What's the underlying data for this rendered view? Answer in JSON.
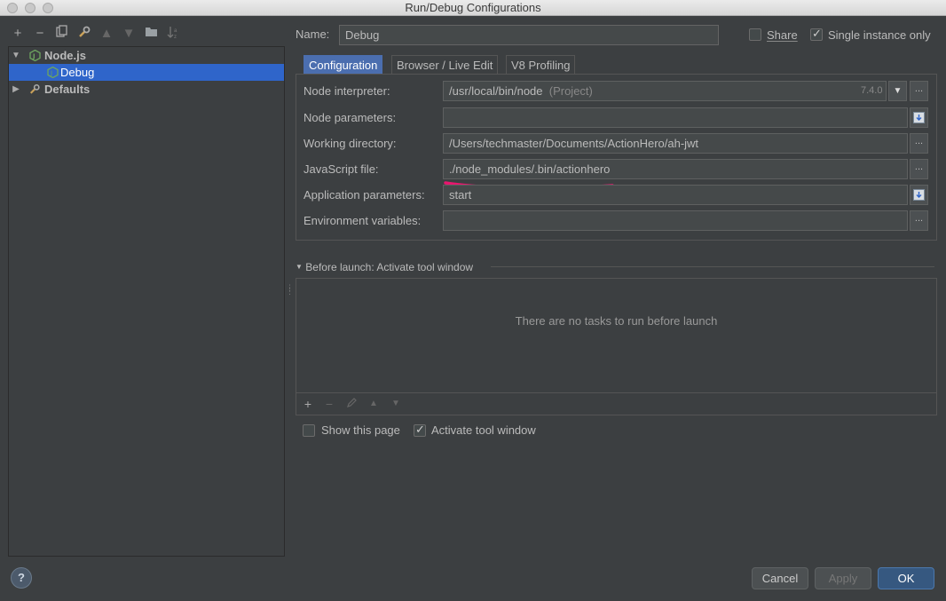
{
  "window": {
    "title": "Run/Debug Configurations"
  },
  "tree": {
    "items": [
      {
        "label": "Node.js",
        "icon": "nodejs-icon"
      },
      {
        "label": "Debug",
        "icon": "nodejs-icon"
      },
      {
        "label": "Defaults",
        "icon": "wrench-icon"
      }
    ]
  },
  "header": {
    "name_label": "Name:",
    "name_value": "Debug",
    "share_label": "Share",
    "single_instance_label": "Single instance only"
  },
  "tabs": [
    {
      "label": "Configuration"
    },
    {
      "label": "Browser / Live Edit"
    },
    {
      "label": "V8 Profiling"
    }
  ],
  "config": {
    "node_interpreter": {
      "label": "Node interpreter:",
      "value": "/usr/local/bin/node",
      "hint": "(Project)",
      "version": "7.4.0"
    },
    "node_parameters": {
      "label": "Node parameters:",
      "value": ""
    },
    "working_directory": {
      "label": "Working directory:",
      "value": "/Users/techmaster/Documents/ActionHero/ah-jwt"
    },
    "javascript_file": {
      "label": "JavaScript file:",
      "value": "./node_modules/.bin/actionhero"
    },
    "application_parameters": {
      "label": "Application parameters:",
      "value": "start"
    },
    "environment_variables": {
      "label": "Environment variables:",
      "value": ""
    }
  },
  "before_launch": {
    "title": "Before launch: Activate tool window",
    "empty_text": "There are no tasks to run before launch",
    "show_this_page_label": "Show this page",
    "activate_tool_window_label": "Activate tool window"
  },
  "buttons": {
    "help": "?",
    "cancel": "Cancel",
    "apply": "Apply",
    "ok": "OK"
  },
  "colors": {
    "background": "#3c3f41",
    "selection": "#2f65ca",
    "active_tab": "#4b6eaf",
    "primary_button": "#365880",
    "annotation": "#e8166e"
  }
}
